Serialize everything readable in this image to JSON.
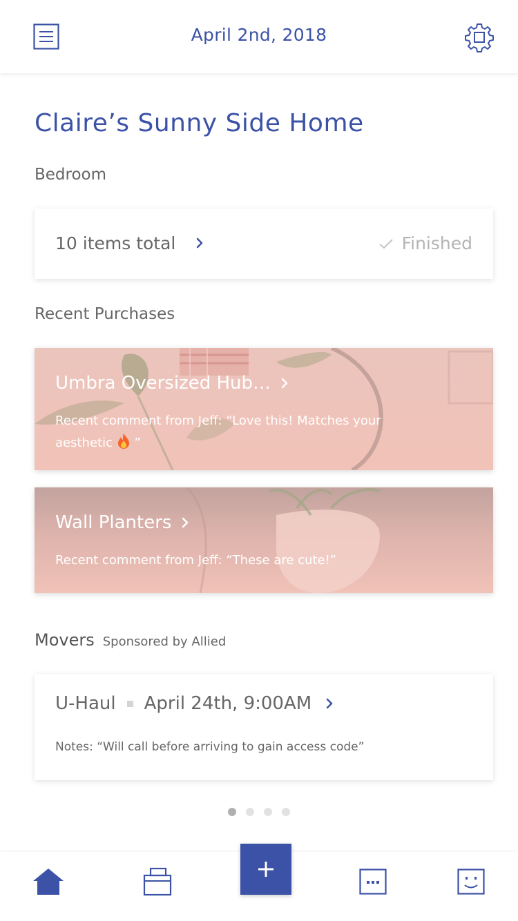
{
  "header": {
    "date": "April 2nd, 2018",
    "menu_icon": "menu-icon",
    "settings_icon": "gear-icon"
  },
  "home": {
    "title": "Claire’s Sunny Side Home"
  },
  "bedroom": {
    "label": "Bedroom",
    "items_total": "10 items total",
    "status": "Finished"
  },
  "purchases": {
    "label": "Recent Purchases",
    "items": [
      {
        "title": "Umbra Oversized Hub…",
        "comment": "Recent comment from Jeff: “Love this! Matches your aesthetic",
        "comment_end": "”"
      },
      {
        "title": "Wall Planters",
        "comment": "Recent comment from Jeff: “These are cute!”"
      }
    ]
  },
  "movers": {
    "label": "Movers",
    "sponsor": "Sponsored by Allied",
    "company": "U-Haul",
    "datetime": "April 24th, 9:00AM",
    "notes": "Notes: “Will call before arriving to gain access code”"
  },
  "pagination": {
    "count": 4,
    "active_index": 0
  },
  "nav": {
    "items": [
      "home-icon",
      "bag-icon",
      "add-icon",
      "chat-icon",
      "face-icon"
    ],
    "active": "home-icon"
  },
  "colors": {
    "accent": "#3b52a6",
    "muted_text": "#666666",
    "finished_text": "#b4b4b4",
    "card_pink": "#f2c2b8"
  }
}
